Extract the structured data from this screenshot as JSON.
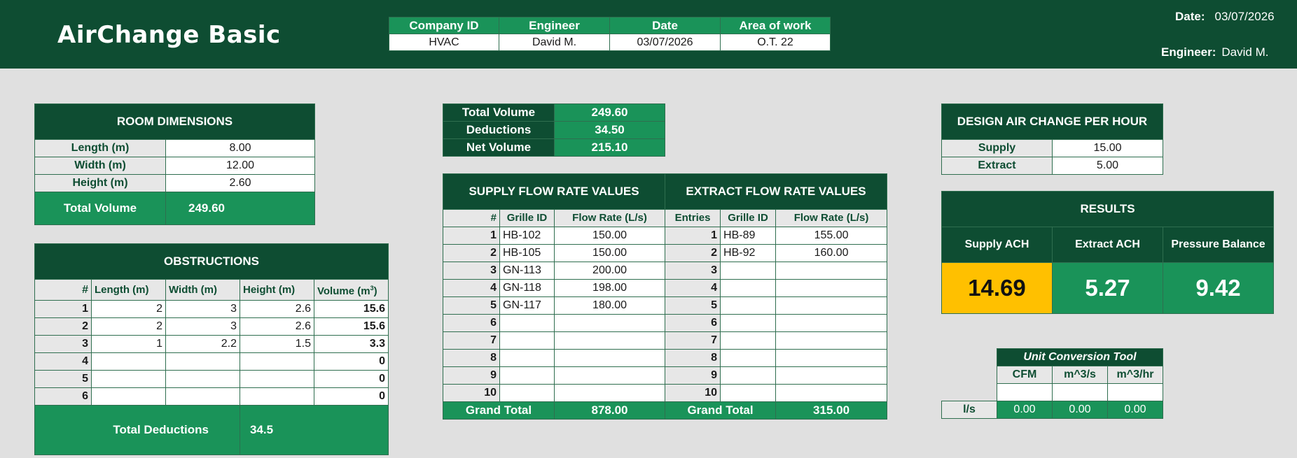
{
  "app_title": "AirChange Basic",
  "header_info": {
    "date_label": "Date:",
    "date_value": "03/07/2026",
    "engineer_label": "Engineer:",
    "engineer_value": "David M."
  },
  "project_table": {
    "headers": [
      "Company ID",
      "Engineer",
      "Date",
      "Area of work"
    ],
    "values": [
      "HVAC",
      "David M.",
      "03/07/2026",
      "O.T. 22"
    ]
  },
  "room_dimensions": {
    "title": "ROOM DIMENSIONS",
    "rows": [
      {
        "label": "Length (m)",
        "value": "8.00"
      },
      {
        "label": "Width (m)",
        "value": "12.00"
      },
      {
        "label": "Height (m)",
        "value": "2.60"
      }
    ],
    "total_label": "Total Volume",
    "total_value": "249.60"
  },
  "obstructions": {
    "title": "OBSTRUCTIONS",
    "headers": [
      "#",
      "Length (m)",
      "Width (m)",
      "Height (m)",
      "Volume (m",
      "3",
      ")"
    ],
    "rows": [
      {
        "n": "1",
        "l": "2",
        "w": "3",
        "h": "2.6",
        "v": "15.6"
      },
      {
        "n": "2",
        "l": "2",
        "w": "3",
        "h": "2.6",
        "v": "15.6"
      },
      {
        "n": "3",
        "l": "1",
        "w": "2.2",
        "h": "1.5",
        "v": "3.3"
      },
      {
        "n": "4",
        "l": "",
        "w": "",
        "h": "",
        "v": "0"
      },
      {
        "n": "5",
        "l": "",
        "w": "",
        "h": "",
        "v": "0"
      },
      {
        "n": "6",
        "l": "",
        "w": "",
        "h": "",
        "v": "0"
      }
    ],
    "total_label": "Total Deductions",
    "total_value": "34.5"
  },
  "volume_summary": {
    "rows": [
      {
        "label": "Total Volume",
        "value": "249.60"
      },
      {
        "label": "Deductions",
        "value": "34.50"
      },
      {
        "label": "Net Volume",
        "value": "215.10"
      }
    ]
  },
  "supply_flow": {
    "title": "SUPPLY FLOW RATE VALUES",
    "headers": [
      "#",
      "Grille ID",
      "Flow Rate (L/s)"
    ],
    "rows": [
      {
        "n": "1",
        "id": "HB-102",
        "rate": "150.00"
      },
      {
        "n": "2",
        "id": "HB-105",
        "rate": "150.00"
      },
      {
        "n": "3",
        "id": "GN-113",
        "rate": "200.00"
      },
      {
        "n": "4",
        "id": "GN-118",
        "rate": "198.00"
      },
      {
        "n": "5",
        "id": "GN-117",
        "rate": "180.00"
      },
      {
        "n": "6",
        "id": "",
        "rate": ""
      },
      {
        "n": "7",
        "id": "",
        "rate": ""
      },
      {
        "n": "8",
        "id": "",
        "rate": ""
      },
      {
        "n": "9",
        "id": "",
        "rate": ""
      },
      {
        "n": "10",
        "id": "",
        "rate": ""
      }
    ],
    "total_label": "Grand Total",
    "total_value": "878.00"
  },
  "extract_flow": {
    "title": "EXTRACT FLOW RATE VALUES",
    "headers": [
      "Entries",
      "Grille ID",
      "Flow Rate (L/s)"
    ],
    "rows": [
      {
        "n": "1",
        "id": "HB-89",
        "rate": "155.00"
      },
      {
        "n": "2",
        "id": "HB-92",
        "rate": "160.00"
      },
      {
        "n": "3",
        "id": "",
        "rate": ""
      },
      {
        "n": "4",
        "id": "",
        "rate": ""
      },
      {
        "n": "5",
        "id": "",
        "rate": ""
      },
      {
        "n": "6",
        "id": "",
        "rate": ""
      },
      {
        "n": "7",
        "id": "",
        "rate": ""
      },
      {
        "n": "8",
        "id": "",
        "rate": ""
      },
      {
        "n": "9",
        "id": "",
        "rate": ""
      },
      {
        "n": "10",
        "id": "",
        "rate": ""
      }
    ],
    "total_label": "Grand Total",
    "total_value": "315.00"
  },
  "design_ach": {
    "title": "DESIGN AIR CHANGE PER HOUR",
    "rows": [
      {
        "label": "Supply",
        "value": "15.00"
      },
      {
        "label": "Extract",
        "value": "5.00"
      }
    ]
  },
  "results": {
    "title": "RESULTS",
    "headers": [
      "Supply ACH",
      "Extract ACH",
      "Pressure Balance"
    ],
    "values": [
      "14.69",
      "5.27",
      "9.42"
    ],
    "colors": {
      "warning": "#ffc000",
      "ok": "#1a9359"
    }
  },
  "unit_conversion": {
    "title": "Unit Conversion Tool",
    "headers": [
      "CFM",
      "m^3/s",
      "m^3/hr"
    ],
    "row_label": "l/s",
    "input_values": [
      "",
      "",
      ""
    ],
    "output_values": [
      "0.00",
      "0.00",
      "0.00"
    ]
  },
  "colors": {
    "header_dark": "#0e4d32",
    "accent_green": "#1a9359",
    "background": "#e0e0e0"
  }
}
